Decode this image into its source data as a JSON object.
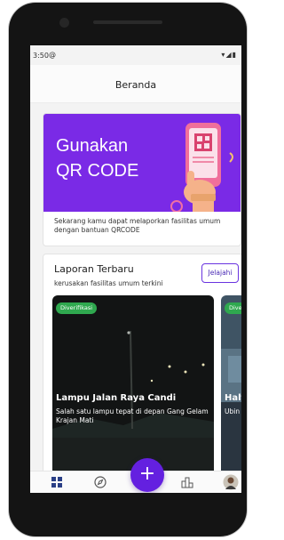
{
  "status_bar": {
    "time": "3:50",
    "notification_icon": "at-icon",
    "icons": "▾◢▮"
  },
  "app_bar": {
    "title": "Beranda"
  },
  "banner": {
    "headline_line1": "Gunakan",
    "headline_line2": "QR CODE",
    "description": "Sekarang kamu dapat melaporkan fasilitas umum dengan bantuan QRCODE",
    "background_color": "#7a2ae6"
  },
  "reports": {
    "heading": "Laporan Terbaru",
    "subheading": "kerusakan fasilitas umum terkini",
    "explore_label": "Jelajahi",
    "cards": [
      {
        "badge": "Diverifikasi",
        "title": "Lampu Jalan Raya Candi",
        "description": "Salah satu lampu tepat di depan Gang Gelam Krajan Mati"
      },
      {
        "badge": "Diverifikasi",
        "title": "Halte",
        "description": "Ubin r... mati"
      }
    ]
  },
  "bottom_nav": {
    "items": [
      {
        "name": "home",
        "icon": "grid-icon",
        "active": true
      },
      {
        "name": "explore",
        "icon": "compass-icon",
        "active": false
      },
      {
        "name": "add",
        "icon": "plus-icon",
        "label": "+"
      },
      {
        "name": "buildings",
        "icon": "building-icon",
        "active": false
      },
      {
        "name": "profile",
        "icon": "avatar",
        "active": false
      }
    ]
  },
  "colors": {
    "primary": "#6420e0",
    "badge": "#2fa84f"
  }
}
